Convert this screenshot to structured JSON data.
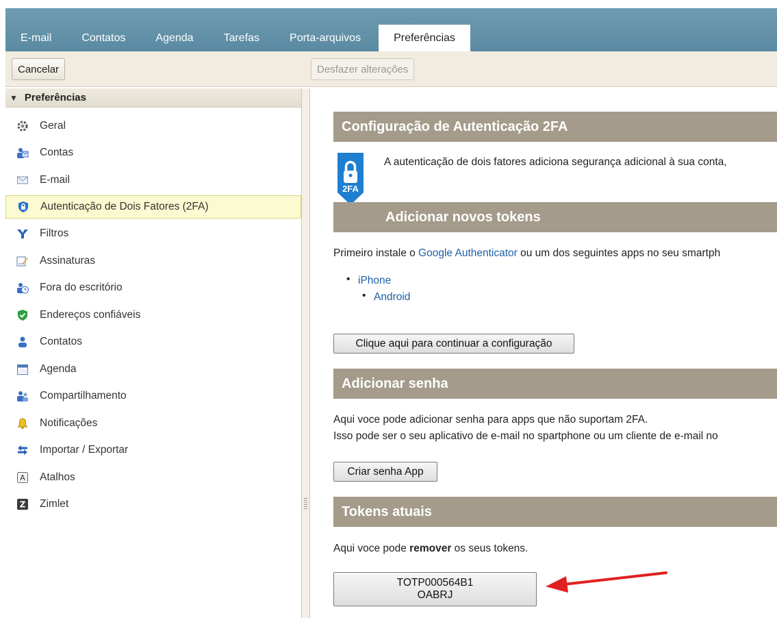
{
  "tabs": [
    {
      "label": "E-mail"
    },
    {
      "label": "Contatos"
    },
    {
      "label": "Agenda"
    },
    {
      "label": "Tarefas"
    },
    {
      "label": "Porta-arquivos"
    },
    {
      "label": "Preferências"
    }
  ],
  "toolbar": {
    "cancel_label": "Cancelar",
    "undo_label": "Desfazer alterações"
  },
  "sidebar": {
    "header": "Preferências",
    "items": [
      {
        "label": "Geral",
        "icon": "gear-icon"
      },
      {
        "label": "Contas",
        "icon": "accounts-icon"
      },
      {
        "label": "E-mail",
        "icon": "envelope-icon"
      },
      {
        "label": "Autenticação de Dois Fatores (2FA)",
        "icon": "shield-lock-icon"
      },
      {
        "label": "Filtros",
        "icon": "filter-icon"
      },
      {
        "label": "Assinaturas",
        "icon": "signature-icon"
      },
      {
        "label": "Fora do escritório",
        "icon": "out-of-office-icon"
      },
      {
        "label": "Endereços confiáveis",
        "icon": "trusted-shield-icon"
      },
      {
        "label": "Contatos",
        "icon": "contact-icon"
      },
      {
        "label": "Agenda",
        "icon": "calendar-icon"
      },
      {
        "label": "Compartilhamento",
        "icon": "sharing-icon"
      },
      {
        "label": "Notificações",
        "icon": "bell-icon"
      },
      {
        "label": "Importar / Exportar",
        "icon": "import-export-icon"
      },
      {
        "label": "Atalhos",
        "icon": "shortcut-key-icon"
      },
      {
        "label": "Zimlet",
        "icon": "zimlet-icon"
      }
    ]
  },
  "main": {
    "config_title": "Configuração de Autenticação 2FA",
    "badge_text": "2FA",
    "intro": "A autenticação de dois fatores adiciona segurança adicional à sua conta,",
    "add_tokens_title": "Adicionar novos tokens",
    "install_prefix": "Primeiro instale o ",
    "install_link": "Google Authenticator",
    "install_suffix": " ou um dos seguintes apps no seu smartph",
    "apps": [
      "iPhone",
      "Android"
    ],
    "continue_button": "Clique aqui para continuar a configuração",
    "add_password_title": "Adicionar senha",
    "password_line1": "Aqui voce pode adicionar senha para apps que não suportam 2FA.",
    "password_line2": "Isso pode ser o seu aplicativo de e-mail no spartphone ou um cliente de e-mail no",
    "create_password_button": "Criar senha App",
    "tokens_title": "Tokens atuais",
    "remove_prefix": "Aqui voce pode ",
    "remove_bold": "remover",
    "remove_suffix": " os seus tokens.",
    "token_id": "TOTP000564B1",
    "token_name": "OABRJ"
  },
  "colors": {
    "appbar": "#5f8fa6",
    "section_header": "#a59b8b",
    "toolbar_bg": "#f1ecdf",
    "selected_bg": "#fbfad0",
    "link": "#1f5fa8",
    "arrow": "#e02020"
  }
}
